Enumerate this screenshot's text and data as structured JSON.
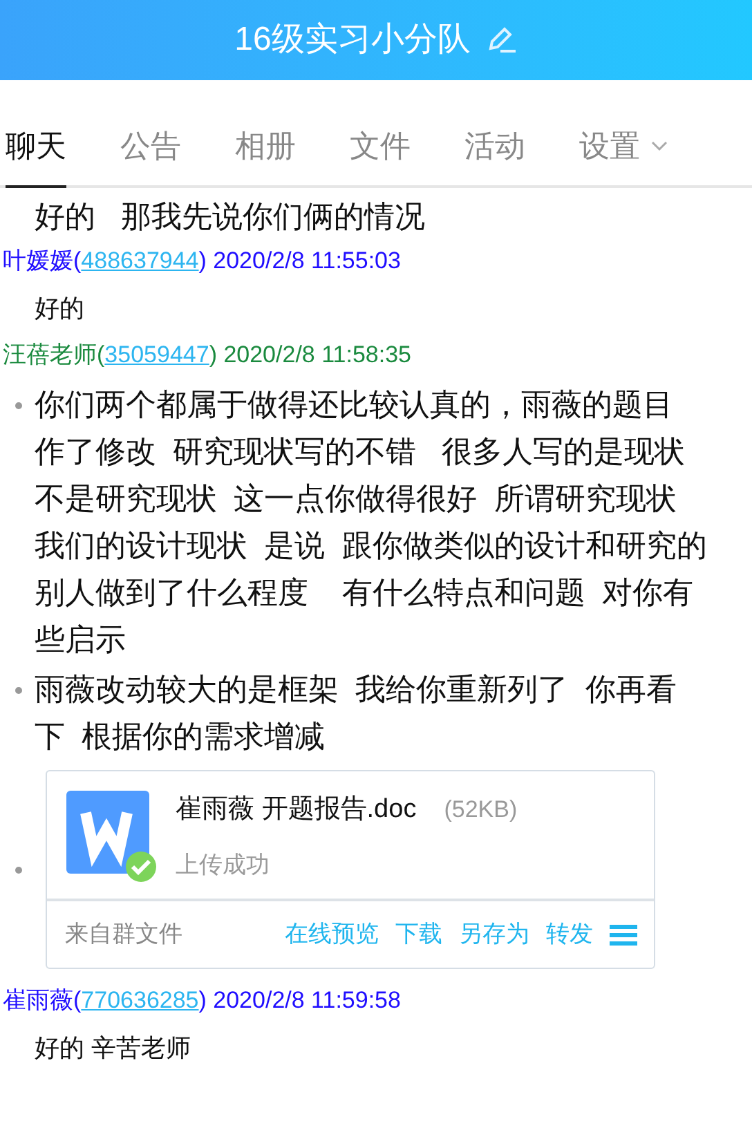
{
  "header": {
    "title": "16级实习小分队"
  },
  "tabs": [
    {
      "label": "聊天",
      "selected": true,
      "has_menu": false
    },
    {
      "label": "公告",
      "selected": false,
      "has_menu": false
    },
    {
      "label": "相册",
      "selected": false,
      "has_menu": false
    },
    {
      "label": "文件",
      "selected": false,
      "has_menu": false
    },
    {
      "label": "活动",
      "selected": false,
      "has_menu": false
    },
    {
      "label": "设置",
      "selected": false,
      "has_menu": true
    }
  ],
  "messages": [
    {
      "kind": "lead_text",
      "lines": [
        "好的   那我先说你们俩的情况"
      ]
    },
    {
      "kind": "meta",
      "name": "叶媛媛(",
      "qq": "488637944",
      "time": ") 2020/2/8 11:55:03",
      "color": "#1f0dff"
    },
    {
      "kind": "text",
      "lines": [
        "好的"
      ]
    },
    {
      "kind": "meta",
      "name": "汪蓓老师(",
      "qq": "35059447",
      "time": ") 2020/2/8 11:58:35",
      "color": "#1a8a3e"
    },
    {
      "kind": "bullet",
      "lines": [
        "你们两个都属于做得还比较认真的，雨薇的题目",
        "作了修改  研究现状写的不错   很多人写的是现状",
        "不是研究现状  这一点你做得很好  所谓研究现状",
        "我们的设计现状  是说  跟你做类似的设计和研究的",
        "别人做到了什么程度    有什么特点和问题  对你有",
        "些启示"
      ]
    },
    {
      "kind": "bullet",
      "lines": [
        "雨薇改动较大的是框架  我给你重新列了  你再看",
        "下  根据你的需求增减"
      ]
    },
    {
      "kind": "file",
      "filename": "崔雨薇 开题报告.doc",
      "size": "(52KB)",
      "status": "上传成功",
      "source": "来自群文件",
      "actions": [
        "在线预览",
        "下载",
        "另存为",
        "转发"
      ]
    },
    {
      "kind": "meta",
      "name": "崔雨薇(",
      "qq": "770636285",
      "time": ") 2020/2/8 11:59:58",
      "color": "#1f0dff"
    },
    {
      "kind": "text",
      "lines": [
        "好的 辛苦老师"
      ]
    }
  ]
}
